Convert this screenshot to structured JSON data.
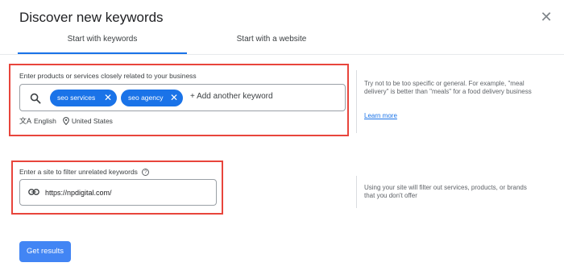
{
  "header": {
    "title": "Discover new keywords",
    "close_icon": "close-icon"
  },
  "tabs": [
    {
      "label": "Start with keywords",
      "active": true
    },
    {
      "label": "Start with a website",
      "active": false
    }
  ],
  "keywords_section": {
    "label": "Enter products or services closely related to your business",
    "chips": [
      {
        "label": "seo services"
      },
      {
        "label": "seo agency"
      }
    ],
    "chip_remove_glyph": "✕",
    "placeholder": "+ Add another keyword",
    "language": "English",
    "location": "United States"
  },
  "keywords_tip": {
    "text": "Try not to be too specific or general. For example, \"meal delivery\" is better than \"meals\" for a food delivery business",
    "link": "Learn more"
  },
  "site_section": {
    "label": "Enter a site to filter unrelated keywords",
    "help_glyph": "?",
    "value": "https://npdigital.com/"
  },
  "site_tip": {
    "text": "Using your site will filter out services, products, or brands that you don't offer"
  },
  "actions": {
    "submit_label": "Get results"
  },
  "colors": {
    "accent": "#1a73e8",
    "button": "#4285f4",
    "highlight": "#e8453c"
  }
}
